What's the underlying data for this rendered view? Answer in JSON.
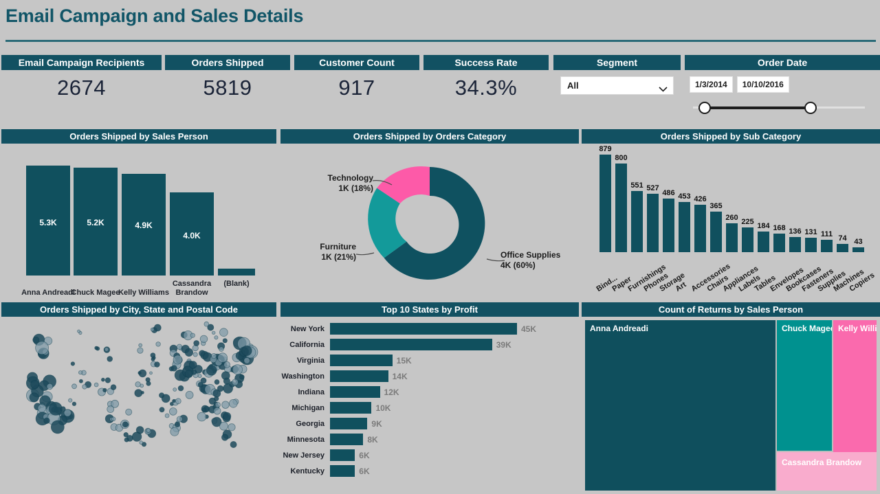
{
  "header": {
    "title": "Email Campaign and Sales Details"
  },
  "kpis": [
    {
      "label": "Email Campaign Recipients",
      "value": "2674"
    },
    {
      "label": "Orders Shipped",
      "value": "5819"
    },
    {
      "label": "Customer Count",
      "value": "917"
    },
    {
      "label": "Success Rate",
      "value": "34.3%"
    }
  ],
  "segment_slicer": {
    "label": "Segment",
    "value": "All",
    "chevron": "chevron-down-icon"
  },
  "order_date_slicer": {
    "label": "Order Date",
    "start": "1/3/2014",
    "end": "10/10/2016"
  },
  "panels": {
    "sales_person": "Orders Shipped by Sales Person",
    "orders_category": "Orders Shipped by Orders Category",
    "sub_category": "Orders Shipped by Sub Category",
    "map": "Orders Shipped by City, State and Postal Code",
    "top_states": "Top 10 States by Profit",
    "returns": "Count of Returns by Sales Person"
  },
  "colors": {
    "accent_teal": "#125162",
    "bar_teal": "#10505e",
    "bright_teal": "#00918f",
    "pink": "#fa6aad",
    "light_pink": "#f9accd",
    "background": "#c6c6c6",
    "title": "#115567",
    "kpi_value": "#1b2438"
  },
  "chart_data": [
    {
      "type": "bar",
      "title": "Orders Shipped by Sales Person",
      "xlabel": "",
      "ylabel": "",
      "categories": [
        "Anna Andreadi",
        "Chuck Magee",
        "Kelly Williams",
        "Cassandra Brandow",
        "(Blank)"
      ],
      "values": [
        5300,
        5200,
        4900,
        4000,
        160
      ],
      "labels": [
        "5.3K",
        "5.2K",
        "4.9K",
        "4.0K",
        ""
      ],
      "ylim": [
        0,
        5600
      ],
      "grid": false,
      "legend": "none"
    },
    {
      "type": "pie",
      "title": "Orders Shipped by Orders Category",
      "donut": true,
      "slices": [
        {
          "name": "Office Supplies",
          "value": 4000,
          "percent": 60,
          "label": "Office Supplies\n4K (60%)",
          "color": "#0f5160"
        },
        {
          "name": "Furniture",
          "value": 1000,
          "percent": 21,
          "label": "Furniture\n1K (21%)",
          "color": "#139a9a"
        },
        {
          "name": "Technology",
          "value": 1000,
          "percent": 18,
          "label": "Technology\n1K (18%)",
          "color": "#fd5aa8"
        }
      ],
      "legend": "labels-outside"
    },
    {
      "type": "bar",
      "title": "Orders Shipped by Sub Category",
      "xlabel": "",
      "ylabel": "",
      "categories": [
        "Bind...",
        "Paper",
        "Furnishings",
        "Phones",
        "Storage",
        "Art",
        "Accessories",
        "Chairs",
        "Appliances",
        "Labels",
        "Tables",
        "Envelopes",
        "Bookcases",
        "Fasteners",
        "Supplies",
        "Machines",
        "Copiers"
      ],
      "values": [
        879,
        800,
        551,
        527,
        486,
        453,
        426,
        365,
        260,
        225,
        184,
        168,
        136,
        131,
        111,
        74,
        43
      ],
      "ylim": [
        0,
        900
      ],
      "grid": false,
      "legend": "none"
    },
    {
      "type": "scatter",
      "title": "Orders Shipped by City, State and Postal Code",
      "subtitle": "bubble map of United States cities sized by orders shipped",
      "xlabel": "",
      "ylabel": "",
      "legend": "none"
    },
    {
      "type": "bar",
      "orientation": "horizontal",
      "title": "Top 10 States by Profit",
      "xlabel": "",
      "ylabel": "",
      "categories": [
        "New York",
        "California",
        "Virginia",
        "Washington",
        "Indiana",
        "Michigan",
        "Georgia",
        "Minnesota",
        "New Jersey",
        "Kentucky"
      ],
      "values": [
        45000,
        39000,
        15000,
        14000,
        12000,
        10000,
        9000,
        8000,
        6000,
        6000
      ],
      "labels": [
        "45K",
        "39K",
        "15K",
        "14K",
        "12K",
        "10K",
        "9K",
        "8K",
        "6K",
        "6K"
      ],
      "xlim": [
        0,
        45000
      ],
      "grid": false,
      "legend": "none"
    },
    {
      "type": "heatmap",
      "subtype": "treemap",
      "title": "Count of Returns by Sales Person",
      "tiles": [
        {
          "name": "Anna Andreadi",
          "color": "#0f4f5d",
          "share": 0.62
        },
        {
          "name": "Chuck Magee",
          "color": "#00918f",
          "share": 0.16
        },
        {
          "name": "Kelly Willi...",
          "color": "#fa6aad",
          "share": 0.15
        },
        {
          "name": "Cassandra Brandow",
          "color": "#f9accd",
          "share": 0.07
        }
      ],
      "legend": "none"
    }
  ]
}
